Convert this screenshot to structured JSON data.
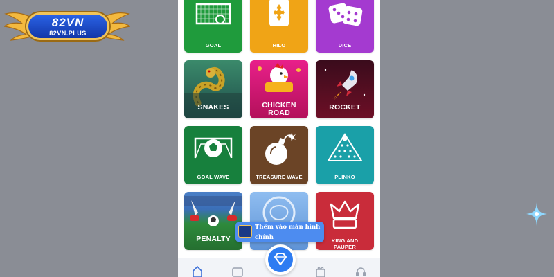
{
  "brand": {
    "logo_text": "82VN",
    "logo_sub": "82VN.PLUS"
  },
  "games": [
    {
      "label": "GOAL",
      "icon": "goal-icon",
      "color": "#1f9b3c"
    },
    {
      "label": "HILO",
      "icon": "diamond-card-icon",
      "color": "#f0a416"
    },
    {
      "label": "DICE",
      "icon": "dice-icon",
      "color": "#a43ad0"
    },
    {
      "label": "SNAKES",
      "icon": "snake-icon",
      "color": "#2f6d6b"
    },
    {
      "label": "CHICKEN ROAD",
      "icon": "chicken-icon",
      "color": "#d1146e"
    },
    {
      "label": "ROCKET",
      "icon": "rocket-icon",
      "color": "#7a1024"
    },
    {
      "label": "GOAL WAVE",
      "icon": "soccer-goal-icon",
      "color": "#17803d"
    },
    {
      "label": "TREASURE WAVE",
      "icon": "bomb-icon",
      "color": "#6b4426"
    },
    {
      "label": "PLINKO",
      "icon": "plinko-icon",
      "color": "#1aa0a8"
    },
    {
      "label": "PENALTY",
      "icon": "penalty-icon",
      "color": "#2e7d32"
    },
    {
      "label": "",
      "icon": "lion-icon",
      "color": "#7aaee6"
    },
    {
      "label": "KING AND PAUPER",
      "icon": "crown-icon",
      "color": "#c92c3a"
    }
  ],
  "toast": {
    "text": "Thêm vào màn hình chính"
  },
  "bottom_nav": {
    "items": [
      "home-icon",
      "mail-icon",
      "diamond-icon",
      "gift-icon",
      "support-icon"
    ]
  }
}
